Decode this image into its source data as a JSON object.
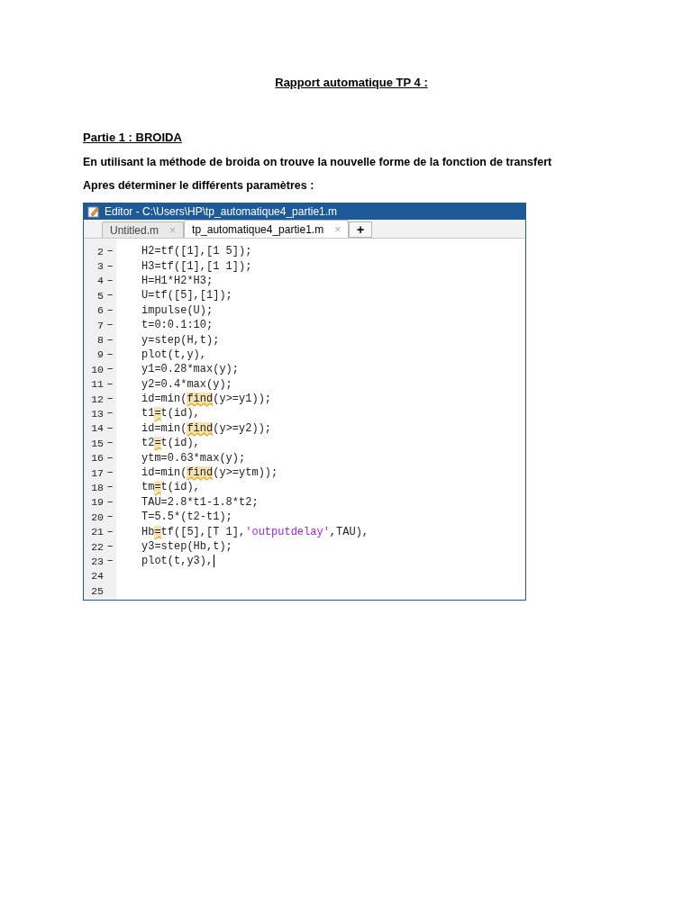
{
  "document": {
    "title": "Rapport automatique TP 4 :",
    "section_heading": "Partie 1 : BROIDA",
    "paragraphs": [
      "En utilisant la méthode de broida on trouve la nouvelle forme de la fonction de transfert",
      "Apres déterminer le différents paramètres :"
    ]
  },
  "editor": {
    "title": "Editor - C:\\Users\\HP\\tp_automatique4_partie1.m",
    "tabs": [
      {
        "label": "Untitled.m",
        "close": "×",
        "selected": false
      },
      {
        "label": "tp_automatique4_partie1.m",
        "close": "×",
        "selected": true
      }
    ],
    "new_tab": "+",
    "lines": [
      {
        "number": "2",
        "marker": "–",
        "parts": [
          {
            "kind": "code",
            "text": "H2=tf([1],[1 5]);"
          }
        ]
      },
      {
        "number": "3",
        "marker": "–",
        "parts": [
          {
            "kind": "code",
            "text": "H3=tf([1],[1 1]);"
          }
        ]
      },
      {
        "number": "4",
        "marker": "–",
        "parts": [
          {
            "kind": "code",
            "text": "H=H1*H2*H3;"
          }
        ]
      },
      {
        "number": "5",
        "marker": "–",
        "parts": [
          {
            "kind": "code",
            "text": "U=tf([5],[1]);"
          }
        ]
      },
      {
        "number": "6",
        "marker": "–",
        "parts": [
          {
            "kind": "code",
            "text": "impulse(U);"
          }
        ]
      },
      {
        "number": "7",
        "marker": "–",
        "parts": [
          {
            "kind": "code",
            "text": "t=0:0.1:10;"
          }
        ]
      },
      {
        "number": "8",
        "marker": "–",
        "parts": [
          {
            "kind": "code",
            "text": "y=step(H,t);"
          }
        ]
      },
      {
        "number": "9",
        "marker": "–",
        "parts": [
          {
            "kind": "code",
            "text": "plot(t,y),"
          }
        ]
      },
      {
        "number": "10",
        "marker": "–",
        "parts": [
          {
            "kind": "code",
            "text": "y1=0.28*max(y);"
          }
        ]
      },
      {
        "number": "11",
        "marker": "–",
        "parts": [
          {
            "kind": "code",
            "text": "y2=0.4*max(y);"
          }
        ]
      },
      {
        "number": "12",
        "marker": "–",
        "parts": [
          {
            "kind": "code",
            "text": "id=min("
          },
          {
            "kind": "warning",
            "text": "find"
          },
          {
            "kind": "code",
            "text": "(y>=y1));"
          }
        ]
      },
      {
        "number": "13",
        "marker": "–",
        "parts": [
          {
            "kind": "code",
            "text": "t1"
          },
          {
            "kind": "warning",
            "text": "="
          },
          {
            "kind": "code",
            "text": "t(id),"
          }
        ]
      },
      {
        "number": "14",
        "marker": "–",
        "parts": [
          {
            "kind": "code",
            "text": "id=min("
          },
          {
            "kind": "warning",
            "text": "find"
          },
          {
            "kind": "code",
            "text": "(y>=y2));"
          }
        ]
      },
      {
        "number": "15",
        "marker": "–",
        "parts": [
          {
            "kind": "code",
            "text": "t2"
          },
          {
            "kind": "warning",
            "text": "="
          },
          {
            "kind": "code",
            "text": "t(id),"
          }
        ]
      },
      {
        "number": "16",
        "marker": "–",
        "parts": [
          {
            "kind": "code",
            "text": "ytm=0.63*max(y);"
          }
        ]
      },
      {
        "number": "17",
        "marker": "–",
        "parts": [
          {
            "kind": "code",
            "text": "id=min("
          },
          {
            "kind": "warning",
            "text": "find"
          },
          {
            "kind": "code",
            "text": "(y>=ytm));"
          }
        ]
      },
      {
        "number": "18",
        "marker": "–",
        "parts": [
          {
            "kind": "code",
            "text": "tm"
          },
          {
            "kind": "warning",
            "text": "="
          },
          {
            "kind": "code",
            "text": "t(id),"
          }
        ]
      },
      {
        "number": "19",
        "marker": "–",
        "parts": [
          {
            "kind": "code",
            "text": "TAU=2.8*t1-1.8*t2;"
          }
        ]
      },
      {
        "number": "20",
        "marker": "–",
        "parts": [
          {
            "kind": "code",
            "text": "T=5.5*(t2-t1);"
          }
        ]
      },
      {
        "number": "21",
        "marker": "–",
        "parts": [
          {
            "kind": "code",
            "text": "Hb"
          },
          {
            "kind": "warning",
            "text": "="
          },
          {
            "kind": "code",
            "text": "tf([5],[T 1],"
          },
          {
            "kind": "string",
            "text": "'outputdelay'"
          },
          {
            "kind": "code",
            "text": ",TAU),"
          }
        ]
      },
      {
        "number": "22",
        "marker": "–",
        "parts": [
          {
            "kind": "code",
            "text": "y3=step(Hb,t);"
          }
        ]
      },
      {
        "number": "23",
        "marker": "–",
        "cursor": true,
        "parts": [
          {
            "kind": "code",
            "text": "plot(t,y3),"
          }
        ]
      },
      {
        "number": "24"
      },
      {
        "number": "25"
      }
    ]
  }
}
